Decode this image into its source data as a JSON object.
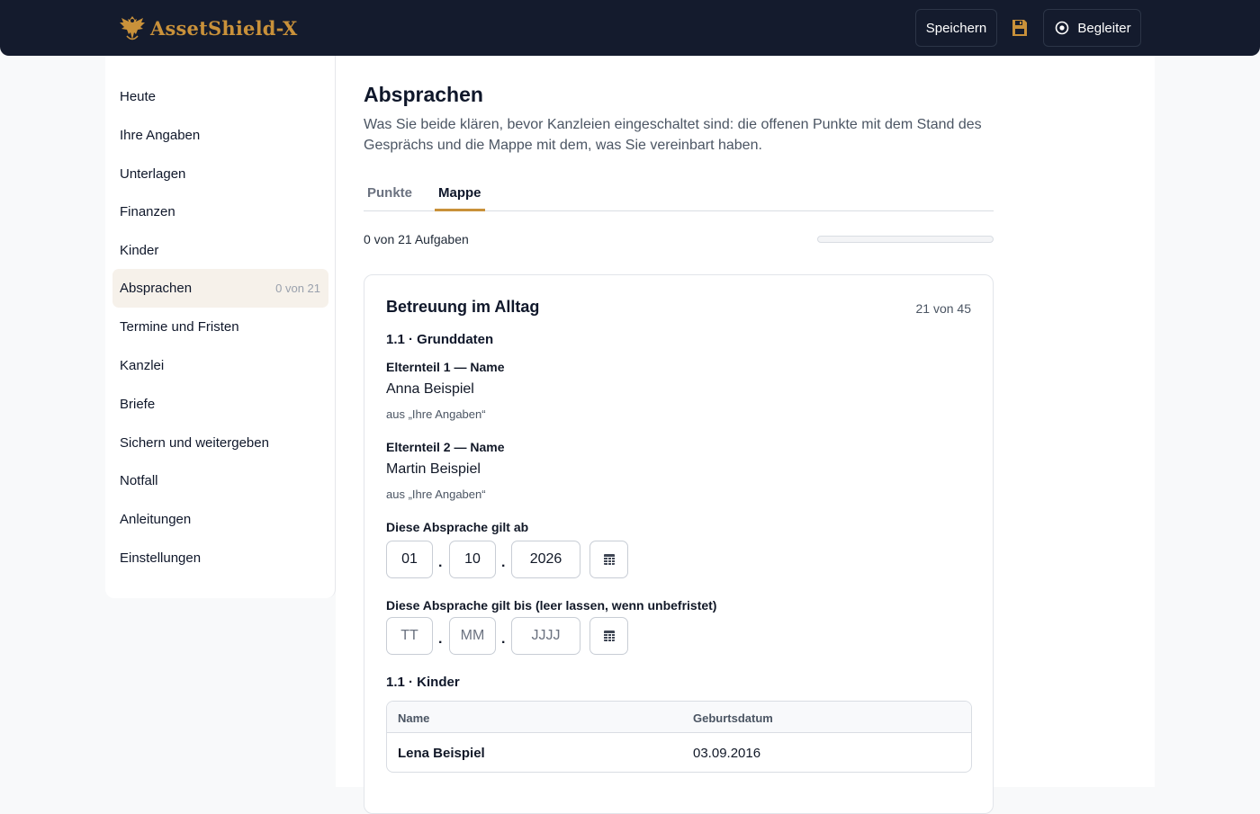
{
  "header": {
    "brand": "AssetShield-X",
    "save_label": "Speichern",
    "companion_label": "Begleiter",
    "brand_color": "#c9913a"
  },
  "sidebar": {
    "items": [
      {
        "label": "Heute"
      },
      {
        "label": "Ihre Angaben"
      },
      {
        "label": "Unterlagen"
      },
      {
        "label": "Finanzen"
      },
      {
        "label": "Kinder"
      },
      {
        "label": "Absprachen",
        "count": "0 von 21",
        "active": true
      },
      {
        "label": "Termine und Fristen"
      },
      {
        "label": "Kanzlei"
      },
      {
        "label": "Briefe"
      },
      {
        "label": "Sichern und weitergeben"
      },
      {
        "label": "Notfall"
      },
      {
        "label": "Anleitungen"
      },
      {
        "label": "Einstellungen"
      }
    ]
  },
  "main": {
    "title": "Absprachen",
    "description": "Was Sie beide klären, bevor Kanzleien eingeschaltet sind: die offenen Punkte mit dem Stand des Gesprächs und die Mappe mit dem, was Sie vereinbart haben.",
    "tabs": [
      {
        "label": "Punkte",
        "active": false
      },
      {
        "label": "Mappe",
        "active": true
      }
    ],
    "progress_label": "0 von 21 Aufgaben",
    "progress_fraction": 0,
    "card": {
      "title": "Betreuung im Alltag",
      "count": "21 von 45",
      "section1": "1.1 · Grunddaten",
      "parent1_label": "Elternteil 1 — Name",
      "parent1_value": "Anna Beispiel",
      "parent1_source": "aus „Ihre Angaben“",
      "parent2_label": "Elternteil 2 — Name",
      "parent2_value": "Martin Beispiel",
      "parent2_source": "aus „Ihre Angaben“",
      "valid_from_label": "Diese Absprache gilt ab",
      "valid_from": {
        "day": "01",
        "month": "10",
        "year": "2026"
      },
      "valid_until_label": "Diese Absprache gilt bis (leer lassen, wenn unbefristet)",
      "valid_until_placeholders": {
        "day": "TT",
        "month": "MM",
        "year": "JJJJ"
      },
      "date_separator": ".",
      "section2": "1.1 · Kinder",
      "kids_table": {
        "headers": [
          "Name",
          "Geburtsdatum"
        ],
        "rows": [
          {
            "name": "Lena Beispiel",
            "birthdate": "03.09.2016"
          }
        ]
      }
    }
  }
}
